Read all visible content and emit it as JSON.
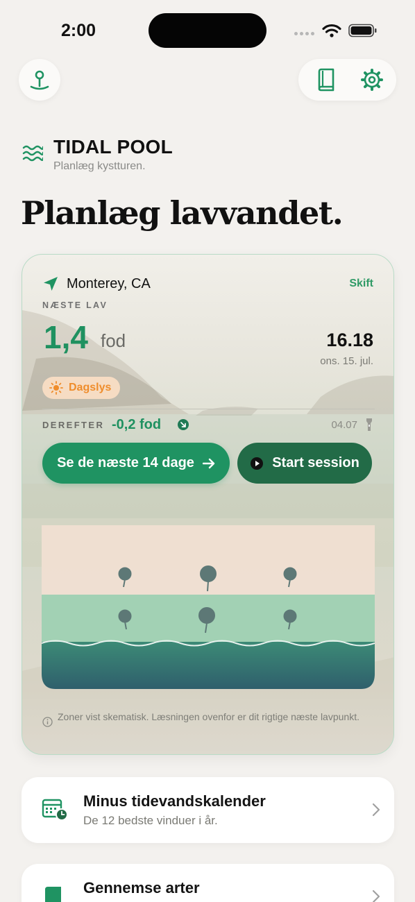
{
  "status_bar": {
    "time": "2:00"
  },
  "brand": {
    "name": "TIDAL POOL",
    "tagline": "Planlæg kystturen."
  },
  "heading": "Planlæg lavvandet.",
  "card": {
    "location": "Monterey, CA",
    "change_label": "Skift",
    "next_low_label": "NÆSTE LAV",
    "next_low_value": "1,4",
    "unit": "fod",
    "next_low_time": "16.18",
    "next_low_date": "ons. 15. jul.",
    "daylight_badge": "Dagslys",
    "after_label": "DEREFTER",
    "after_value": "-0,2 fod",
    "after_time": "04.07",
    "days_button": "Se de næste 14 dage",
    "session_button": "Start session",
    "note": "Zoner vist skematisk. Læsningen ovenfor er dit rigtige næste lavpunkt."
  },
  "list": [
    {
      "title": "Minus tidevandskalender",
      "subtitle": "De 12 bedste vinduer i år.",
      "icon": "calendar-clock-icon"
    },
    {
      "title": "Gennemse arter",
      "subtitle": "",
      "icon": "book-icon"
    }
  ],
  "colors": {
    "accent": "#1f9362",
    "accent_dark": "#226b47",
    "daylight": "#ef8d2c"
  }
}
